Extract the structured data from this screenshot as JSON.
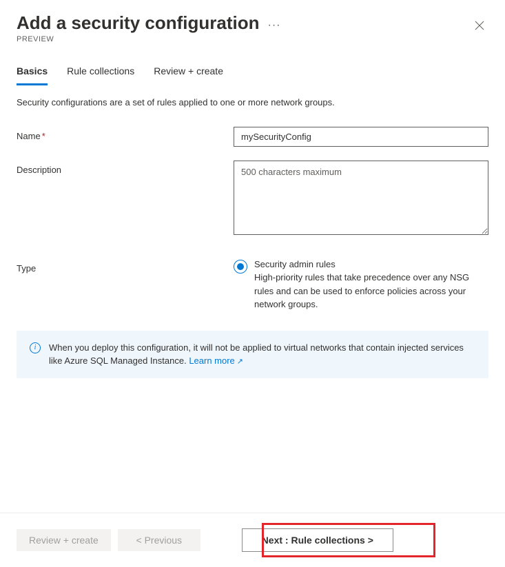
{
  "header": {
    "title": "Add a security configuration",
    "preview": "PREVIEW",
    "ellipsis": "···"
  },
  "tabs": [
    {
      "label": "Basics",
      "active": true
    },
    {
      "label": "Rule collections",
      "active": false
    },
    {
      "label": "Review + create",
      "active": false
    }
  ],
  "intro": "Security configurations are a set of rules applied to one or more network groups.",
  "form": {
    "name": {
      "label": "Name",
      "required": "*",
      "value": "mySecurityConfig"
    },
    "description": {
      "label": "Description",
      "placeholder": "500 characters maximum"
    },
    "type": {
      "label": "Type",
      "option_label": "Security admin rules",
      "option_description": "High-priority rules that take precedence over any NSG rules and can be used to enforce policies across your network groups."
    }
  },
  "info": {
    "text_before": "When you deploy this configuration, it will not be applied to virtual networks that contain injected services like Azure SQL Managed Instance. ",
    "link_text": "Learn more",
    "external_glyph": "↗"
  },
  "footer": {
    "review_create": "Review + create",
    "previous": "< Previous",
    "next": "Next : Rule collections >"
  }
}
